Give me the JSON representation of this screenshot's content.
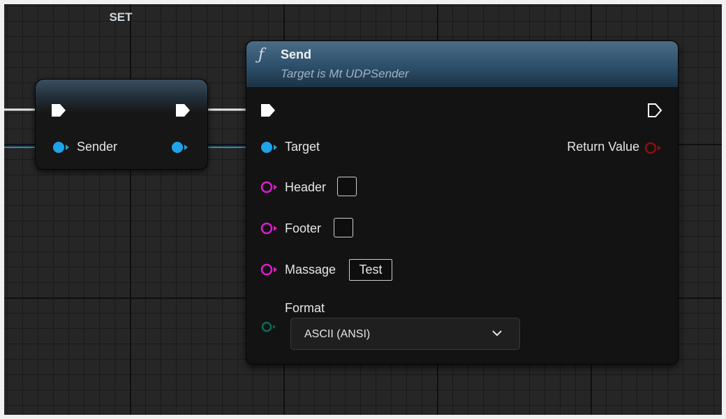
{
  "set_node": {
    "title": "SET",
    "pins": {
      "sender_label": "Sender"
    }
  },
  "send_node": {
    "title": "Send",
    "subtitle": "Target is Mt UDPSender",
    "function_icon_glyph": "ƒ",
    "inputs": {
      "target_label": "Target",
      "header_label": "Header",
      "footer_label": "Footer",
      "massage_label": "Massage",
      "massage_value": "Test",
      "format_label": "Format",
      "format_selected": "ASCII (ANSI)"
    },
    "outputs": {
      "return_value_label": "Return Value"
    }
  },
  "colors": {
    "exec": "#ffffff",
    "object_pin": "#1fa4e8",
    "string_pin": "#e11bd0",
    "byte_pin": "#0d6b55",
    "bool_pin": "#8a0f0f",
    "node_header_blue": "#2b4c66"
  }
}
